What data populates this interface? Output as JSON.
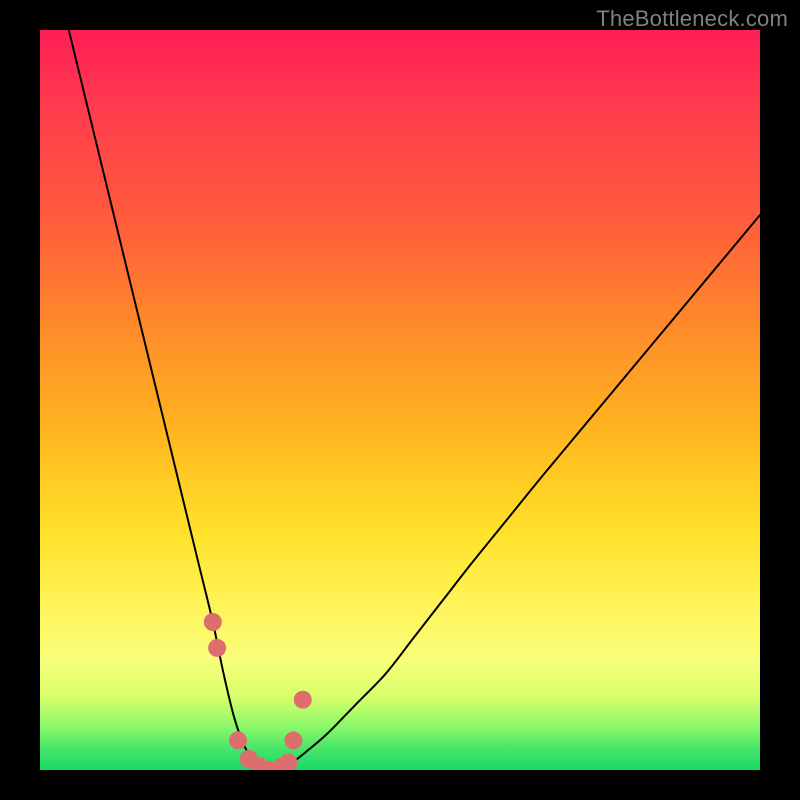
{
  "watermark": "TheBottleneck.com",
  "chart_data": {
    "type": "line",
    "title": "",
    "xlabel": "",
    "ylabel": "",
    "xlim": [
      0,
      100
    ],
    "ylim": [
      0,
      100
    ],
    "series": [
      {
        "name": "bottleneck-curve",
        "x": [
          4,
          6,
          8,
          10,
          12,
          14,
          16,
          18,
          20,
          22,
          24,
          25.5,
          27,
          28.5,
          30,
          31.5,
          33,
          35,
          37,
          40,
          44,
          48,
          52,
          56,
          60,
          65,
          70,
          76,
          82,
          88,
          94,
          100
        ],
        "values": [
          100,
          92,
          84,
          76,
          68,
          60,
          52,
          44,
          36,
          28,
          20,
          13,
          7,
          3,
          1,
          0,
          0,
          1,
          2.5,
          5,
          9,
          13,
          18,
          23,
          28,
          34,
          40,
          47,
          54,
          61,
          68,
          75
        ]
      }
    ],
    "markers": {
      "name": "highlight-dots",
      "color": "#de6e6e",
      "x": [
        24.0,
        24.6,
        27.5,
        29.0,
        30.5,
        32.0,
        33.5,
        34.5,
        35.2,
        36.5
      ],
      "values": [
        20.0,
        16.5,
        4.0,
        1.5,
        0.5,
        0.0,
        0.4,
        1.0,
        4.0,
        9.5
      ]
    }
  }
}
